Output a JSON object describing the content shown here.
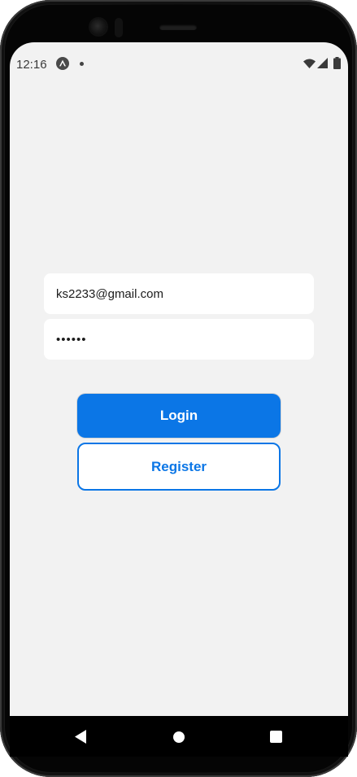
{
  "status_bar": {
    "time": "12:16"
  },
  "form": {
    "email_value": "ks2233@gmail.com",
    "password_value": "••••••"
  },
  "buttons": {
    "login_label": "Login",
    "register_label": "Register"
  },
  "icons": {
    "status": [
      "expo-icon",
      "notification-dot-icon",
      "wifi-icon",
      "signal-icon",
      "battery-icon"
    ],
    "navigation": [
      "back-icon",
      "home-icon",
      "recents-icon"
    ]
  },
  "colors": {
    "accent": "#0b76e6",
    "screen_background": "#f2f2f2",
    "field_background": "#ffffff"
  }
}
